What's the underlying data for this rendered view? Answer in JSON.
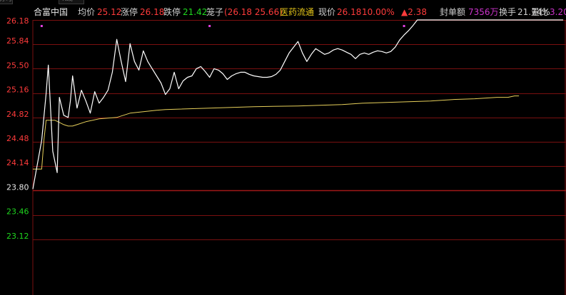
{
  "top_tabs": [
    {
      "label": "分时"
    },
    {
      "label": "K线"
    }
  ],
  "stock": {
    "name": "合富中国",
    "avg_label": "均价",
    "avg_value": "25.12",
    "limit_up_label": "涨停",
    "limit_up_value": "26.18",
    "limit_down_label": "跌停",
    "limit_down_value": "21.42",
    "cage_label": "笼子",
    "cage_value": "(26.18 25.66)",
    "sector": "医药流通",
    "price_label": "现价",
    "price_value": "26.18",
    "pct_change": "10.00%",
    "change": "▲2.38",
    "seal_label": "封单额",
    "seal_value": "7356万",
    "turnover_label": "换手",
    "turnover_value": "21.74%",
    "vol_ratio_label": "量比",
    "vol_ratio_value": "3.20"
  },
  "colors": {
    "background": "#000000",
    "grid": "#7a1010",
    "up": "#ff3b3b",
    "down": "#1fd81f",
    "price_line": "#ffffff",
    "avg_line": "#e6cf5a",
    "sector": "#e6c619",
    "seal_value": "#cc33cc",
    "marker": "#e040e0"
  },
  "chart_data": {
    "type": "line",
    "title": "",
    "xlabel": "",
    "ylabel": "",
    "ylim": [
      22.95,
      26.18
    ],
    "yticks": [
      "26.18",
      "25.84",
      "25.50",
      "25.16",
      "24.82",
      "24.48",
      "24.14",
      "23.80",
      "23.46",
      "23.12"
    ],
    "prev_close": 23.8,
    "x_max": 240,
    "grid": true,
    "series": [
      {
        "key": "price",
        "x": [
          0,
          4,
          6,
          7,
          9,
          11,
          12,
          14,
          16,
          17,
          18,
          20,
          22,
          24,
          26,
          28,
          30,
          32,
          34,
          36,
          38,
          40,
          42,
          44,
          46,
          48,
          50,
          52,
          54,
          56,
          58,
          60,
          62,
          64,
          66,
          68,
          70,
          72,
          74,
          76,
          78,
          80,
          82,
          84,
          86,
          88,
          90,
          92,
          94,
          96,
          98,
          100,
          102,
          104,
          106,
          108,
          110,
          112,
          114,
          116,
          118,
          120,
          122,
          124,
          126,
          128,
          130,
          132,
          134,
          136,
          138,
          140,
          142,
          144,
          146,
          148,
          150,
          152,
          154,
          156,
          158,
          160,
          162,
          164,
          166,
          168,
          170,
          172,
          174,
          176,
          178,
          180,
          182,
          184,
          186,
          188,
          190,
          192,
          194,
          196,
          198,
          200,
          202,
          204,
          206,
          208,
          210,
          212,
          214,
          216,
          218,
          220,
          222,
          224,
          226,
          228,
          230,
          232,
          234,
          236,
          238,
          240
        ],
        "values": [
          23.82,
          24.5,
          25.15,
          25.55,
          24.35,
          24.05,
          25.1,
          24.85,
          24.82,
          25.05,
          25.4,
          24.95,
          25.2,
          25.05,
          24.88,
          25.18,
          25.02,
          25.1,
          25.2,
          25.45,
          25.91,
          25.6,
          25.32,
          25.85,
          25.6,
          25.48,
          25.75,
          25.6,
          25.5,
          25.4,
          25.3,
          25.14,
          25.22,
          25.45,
          25.22,
          25.33,
          25.38,
          25.4,
          25.5,
          25.53,
          25.46,
          25.38,
          25.5,
          25.48,
          25.43,
          25.35,
          25.4,
          25.43,
          25.45,
          25.45,
          25.42,
          25.4,
          25.39,
          25.38,
          25.38,
          25.39,
          25.42,
          25.48,
          25.6,
          25.72,
          25.8,
          25.88,
          25.72,
          25.6,
          25.7,
          25.78,
          25.74,
          25.7,
          25.72,
          25.76,
          25.78,
          25.76,
          25.73,
          25.7,
          25.64,
          25.7,
          25.72,
          25.7,
          25.73,
          25.75,
          25.74,
          25.72,
          25.74,
          25.8,
          25.9,
          25.97,
          26.03,
          26.1,
          26.18,
          26.18,
          26.18,
          26.18,
          26.18,
          26.18,
          26.18,
          26.18,
          26.18,
          26.18,
          26.18,
          26.18,
          26.18,
          26.18,
          26.18,
          26.18,
          26.18,
          26.18,
          26.18,
          26.18,
          26.18,
          26.18,
          26.18,
          26.18,
          26.18,
          26.18,
          26.18,
          26.18,
          26.18,
          26.18,
          26.18,
          26.18,
          26.18,
          26.18
        ]
      },
      {
        "key": "avg",
        "x": [
          0,
          3,
          4,
          5,
          6,
          8,
          10,
          12,
          14,
          16,
          18,
          20,
          24,
          30,
          34,
          38,
          40,
          44,
          50,
          56,
          60,
          80,
          100,
          120,
          140,
          150,
          160,
          170,
          180,
          190,
          200,
          205,
          210,
          215,
          218,
          220
        ],
        "values": [
          24.1,
          24.1,
          24.1,
          24.5,
          24.78,
          24.78,
          24.78,
          24.75,
          24.72,
          24.7,
          24.7,
          24.72,
          24.76,
          24.8,
          24.81,
          24.82,
          24.84,
          24.88,
          24.9,
          24.92,
          24.93,
          24.95,
          24.97,
          24.98,
          25.0,
          25.02,
          25.03,
          25.04,
          25.05,
          25.07,
          25.08,
          25.09,
          25.1,
          25.1,
          25.12,
          25.12
        ]
      }
    ],
    "markers_x": [
      4,
      80,
      168
    ]
  }
}
